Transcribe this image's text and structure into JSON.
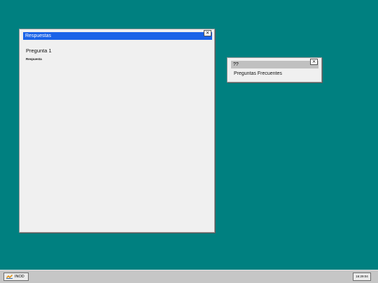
{
  "desktop": {
    "background_color": "#008080"
  },
  "windows": {
    "respuestas": {
      "title": "Respuestas",
      "close_label": "×",
      "question": "Pregunta 1",
      "answer": "Respuesta",
      "title_color": "#1a63e8"
    },
    "faq": {
      "title": "??",
      "close_label": "×",
      "item_label": "Preguntas Frecuentes"
    }
  },
  "taskbar": {
    "start_label": "INOD",
    "start_icon": "start-icon",
    "clock": "16:29:04"
  }
}
